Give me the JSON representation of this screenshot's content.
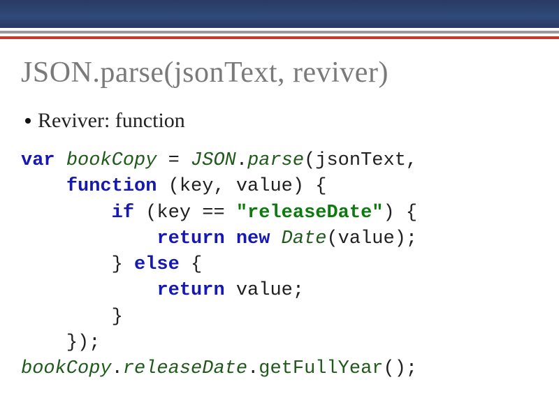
{
  "slide": {
    "title": "JSON.parse(jsonText, reviver)",
    "bullet": "Reviver: function"
  },
  "code": {
    "l1": {
      "kw_var": "var",
      "sp1": " ",
      "ident_book": "bookCopy",
      "eq": " = ",
      "ident_json": "JSON",
      "dot": ".",
      "ident_parse": "parse",
      "tail": "(jsonText,"
    },
    "l2": {
      "indent": "    ",
      "kw_fn": "function",
      "tail": " (key, value) {"
    },
    "l3": {
      "indent": "        ",
      "kw_if": "if",
      "mid": " (key == ",
      "str": "\"releaseDate\"",
      "tail": ") {"
    },
    "l4": {
      "indent": "            ",
      "kw_ret": "return",
      "sp": " ",
      "kw_new": "new",
      "sp2": " ",
      "ident_date": "Date",
      "tail": "(value);"
    },
    "l5": {
      "indent": "        ",
      "brace": "} ",
      "kw_else": "else",
      "tail": " {"
    },
    "l6": {
      "indent": "            ",
      "kw_ret": "return",
      "tail": " value;"
    },
    "l7": {
      "indent": "        ",
      "brace": "}"
    },
    "l8": {
      "indent": "    ",
      "tail": "});"
    },
    "l9": {
      "ident_book": "bookCopy",
      "dot1": ".",
      "ident_release": "releaseDate",
      "dot2": ".",
      "ident_gfy": "getFullYear",
      "tail": "();"
    }
  }
}
